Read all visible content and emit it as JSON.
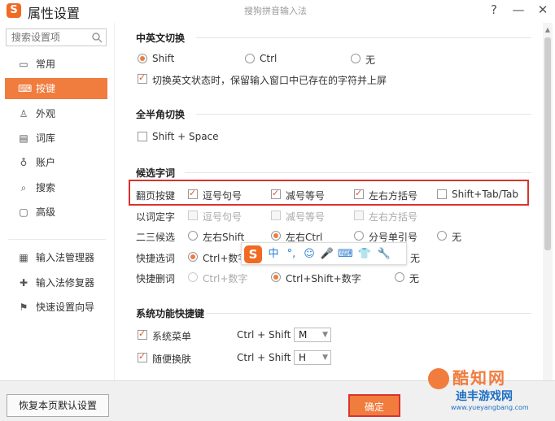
{
  "window": {
    "title": "属性设置",
    "app_name": "搜狗拼音输入法",
    "help": "?",
    "minimize": "—",
    "close": "✕",
    "logo_letter": "S"
  },
  "sidebar": {
    "search_placeholder": "搜索设置项",
    "items": [
      {
        "label": "常用",
        "icon": "monitor-icon"
      },
      {
        "label": "按键",
        "icon": "keyboard-icon",
        "active": true
      },
      {
        "label": "外观",
        "icon": "shirt-icon"
      },
      {
        "label": "词库",
        "icon": "book-icon"
      },
      {
        "label": "账户",
        "icon": "user-icon"
      },
      {
        "label": "搜索",
        "icon": "search-icon"
      },
      {
        "label": "高级",
        "icon": "advanced-icon"
      }
    ],
    "tools": [
      {
        "label": "输入法管理器",
        "icon": "manager-icon"
      },
      {
        "label": "输入法修复器",
        "icon": "repair-icon"
      },
      {
        "label": "快速设置向导",
        "icon": "flag-icon"
      }
    ]
  },
  "sections": {
    "cn_en": {
      "title": "中英文切换",
      "options": [
        "Shift",
        "Ctrl",
        "无"
      ],
      "selected": "Shift",
      "commit_label": "切换英文状态时，保留输入窗口中已存在的字符并上屏",
      "commit_checked": true
    },
    "full_half": {
      "title": "全半角切换",
      "shortcut_label": "Shift + Space",
      "checked": false
    },
    "candidates": {
      "title": "候选字词",
      "page_keys": {
        "label": "翻页按键",
        "options": [
          {
            "label": "逗号句号",
            "checked": true
          },
          {
            "label": "减号等号",
            "checked": true
          },
          {
            "label": "左右方括号",
            "checked": true
          },
          {
            "label": "Shift+Tab/Tab",
            "checked": false
          }
        ]
      },
      "word_fix": {
        "label": "以词定字",
        "options": [
          {
            "label": "逗号句号"
          },
          {
            "label": "减号等号"
          },
          {
            "label": "左右方括号"
          }
        ]
      },
      "second_third": {
        "label": "二三候选",
        "options": [
          "左右Shift",
          "左右Ctrl",
          "分号单引号",
          "无"
        ],
        "selected": "左右Ctrl"
      },
      "quick_select": {
        "label": "快捷选词",
        "options": [
          "Ctrl+数字",
          "无"
        ],
        "selected": "Ctrl+数字"
      },
      "quick_delete": {
        "label": "快捷删词",
        "options": [
          "Ctrl+数字",
          "Ctrl+Shift+数字",
          "无"
        ],
        "selected": "Ctrl+Shift+数字"
      }
    },
    "system": {
      "title": "系统功能快捷键",
      "rows": [
        {
          "label": "系统菜单",
          "checked": true,
          "combo": "Ctrl + Shift +",
          "key": "M"
        },
        {
          "label": "随便换肤",
          "checked": true,
          "combo": "Ctrl + Shift +",
          "key": "H"
        }
      ]
    }
  },
  "float_toolbar": {
    "logo": "S",
    "items": [
      "中",
      "°,",
      "☺",
      "🎤",
      "⌨",
      "👕",
      "🔧"
    ]
  },
  "footer": {
    "reset_label": "恢复本页默认设置",
    "ok_label": "确定"
  },
  "watermark": {
    "brand": "酷知网",
    "brand2": "迪丰游戏网",
    "url": "www.yueyangbang.com"
  },
  "colors": {
    "accent": "#f07c3e",
    "highlight_border": "#d9332e",
    "logo": "#f06a23"
  }
}
